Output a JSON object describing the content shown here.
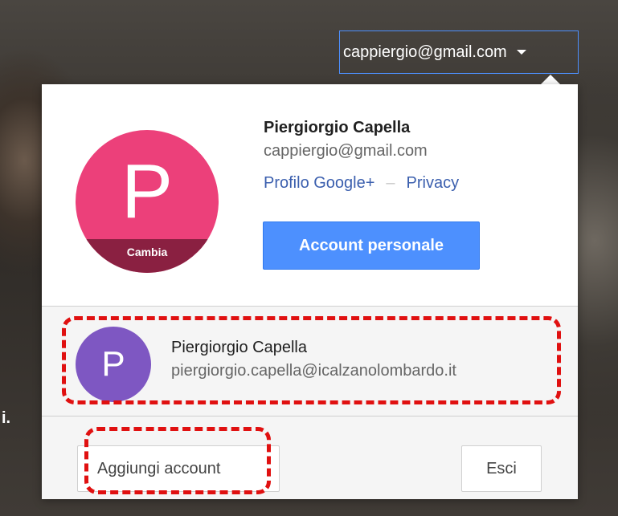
{
  "header": {
    "account_email": "cappiergio@gmail.com",
    "caret_icon": "caret-down-icon"
  },
  "background": {
    "text": "i."
  },
  "current_account": {
    "avatar_initial": "P",
    "avatar_color": "#ec407a",
    "change_label": "Cambia",
    "name": "Piergiorgio Capella",
    "email": "cappiergio@gmail.com",
    "profile_link": "Profilo Google+",
    "separator": "–",
    "privacy_link": "Privacy",
    "personal_button": "Account personale"
  },
  "other_accounts": [
    {
      "avatar_initial": "P",
      "avatar_color": "#7e57c2",
      "name": "Piergiorgio Capella",
      "email": "piergiorgio.capella@icalzanolombardo.it"
    }
  ],
  "footer": {
    "add_account": "Aggiungi account",
    "sign_out": "Esci"
  },
  "colors": {
    "primary_button": "#4d90fe",
    "link": "#3b5fae",
    "annotation": "#e01010"
  }
}
